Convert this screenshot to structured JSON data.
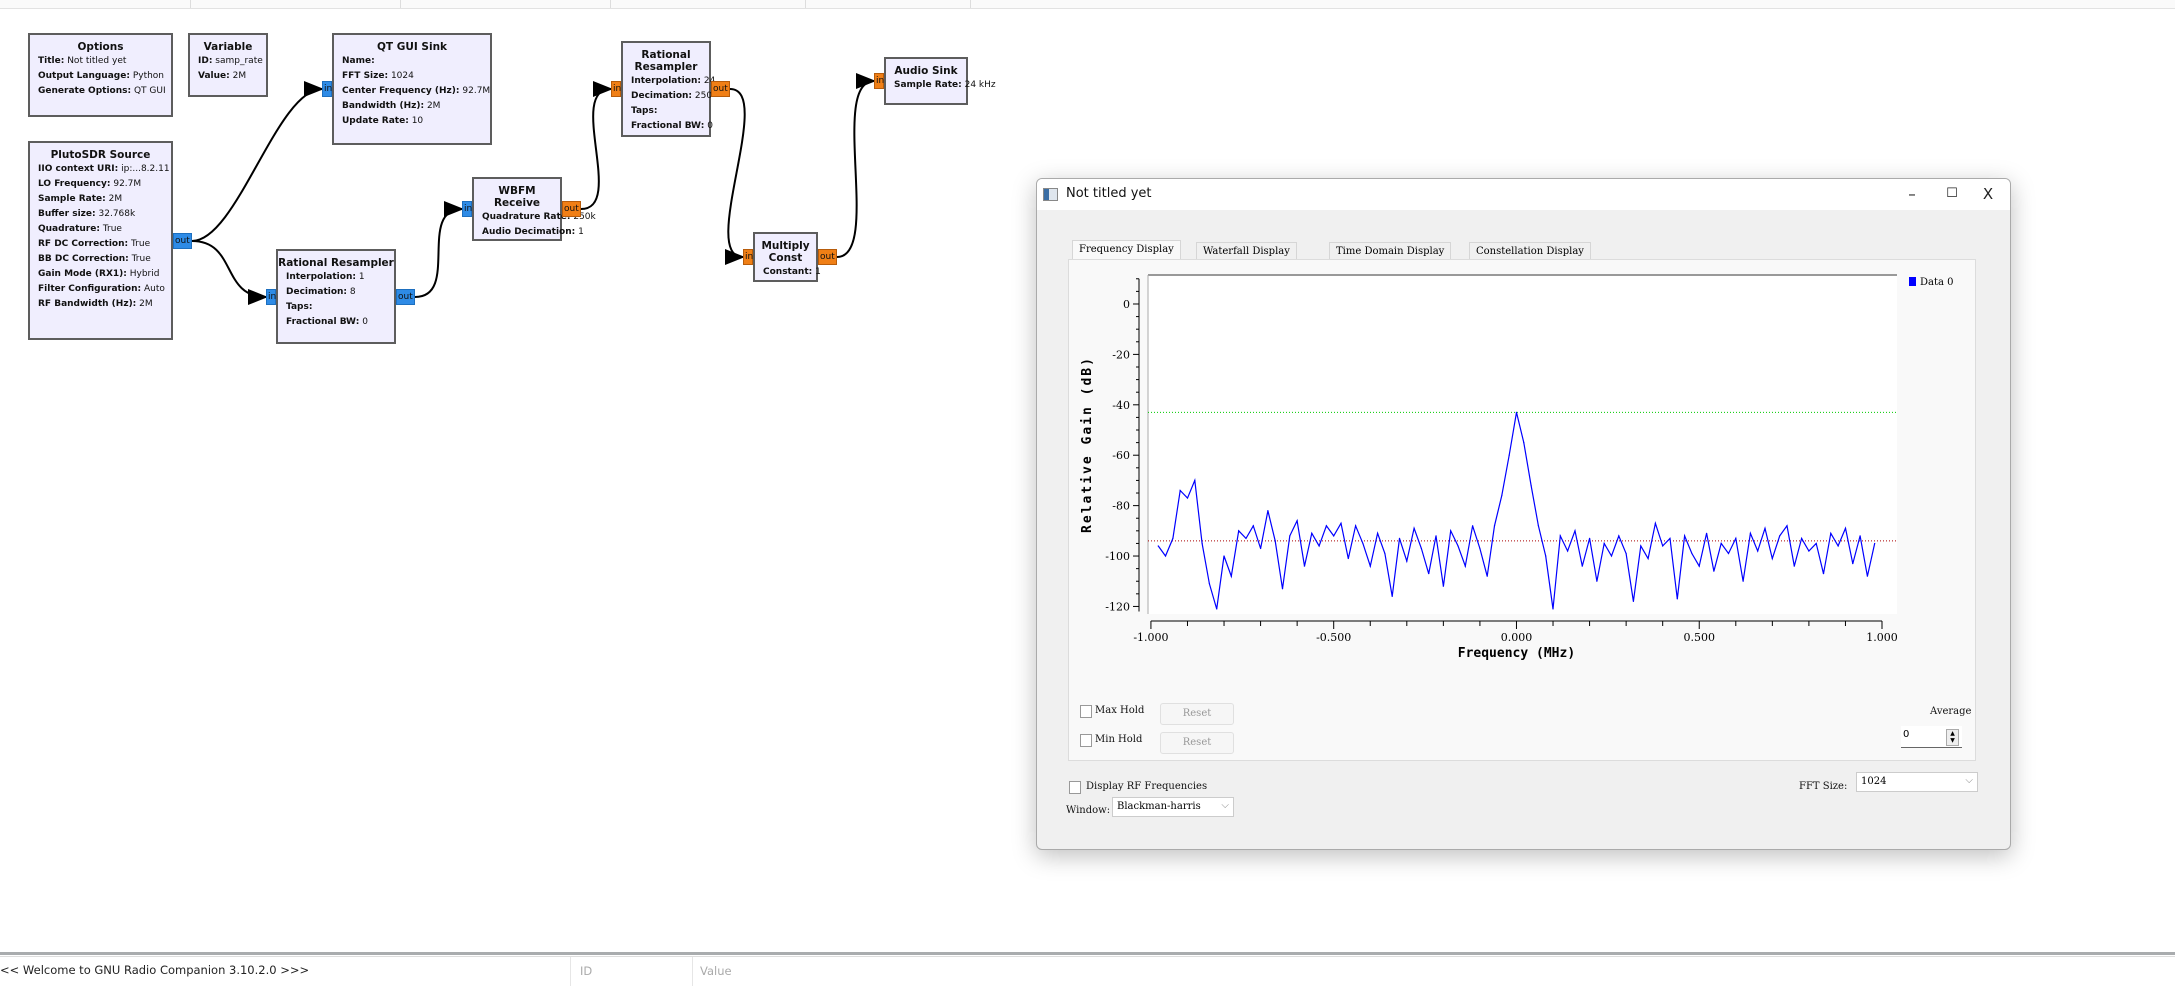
{
  "app": {
    "status_message": "<< Welcome to GNU Radio Companion 3.10.2.0 >>>",
    "variables_panel": {
      "col_id": "ID",
      "col_value": "Value"
    }
  },
  "blocks": [
    {
      "title": "Options",
      "params": [
        {
          "k": "Title:",
          "v": "Not titled yet"
        },
        {
          "k": "Output Language:",
          "v": "Python"
        },
        {
          "k": "Generate Options:",
          "v": "QT GUI"
        }
      ]
    },
    {
      "title": "Variable",
      "params": [
        {
          "k": "ID:",
          "v": "samp_rate"
        },
        {
          "k": "Value:",
          "v": "2M"
        }
      ]
    },
    {
      "title": "QT GUI Sink",
      "params": [
        {
          "k": "Name:",
          "v": ""
        },
        {
          "k": "FFT Size:",
          "v": "1024"
        },
        {
          "k": "Center Frequency (Hz):",
          "v": "92.7M"
        },
        {
          "k": "Bandwidth (Hz):",
          "v": "2M"
        },
        {
          "k": "Update Rate:",
          "v": "10"
        }
      ],
      "in": "in",
      "in_color": "blue"
    },
    {
      "title": "PlutoSDR Source",
      "params": [
        {
          "k": "IIO context URI:",
          "v": "ip:...8.2.11"
        },
        {
          "k": "LO Frequency:",
          "v": "92.7M"
        },
        {
          "k": "Sample Rate:",
          "v": "2M"
        },
        {
          "k": "Buffer size:",
          "v": "32.768k"
        },
        {
          "k": "Quadrature:",
          "v": "True"
        },
        {
          "k": "RF DC Correction:",
          "v": "True"
        },
        {
          "k": "BB DC Correction:",
          "v": "True"
        },
        {
          "k": "Gain Mode (RX1):",
          "v": "Hybrid"
        },
        {
          "k": "Filter Configuration:",
          "v": "Auto"
        },
        {
          "k": "RF Bandwidth (Hz):",
          "v": "2M"
        }
      ],
      "out": "out",
      "out_color": "blue"
    },
    {
      "title": "Rational Resampler",
      "params": [
        {
          "k": "Interpolation:",
          "v": "1"
        },
        {
          "k": "Decimation:",
          "v": "8"
        },
        {
          "k": "Taps:",
          "v": ""
        },
        {
          "k": "Fractional BW:",
          "v": "0"
        }
      ],
      "in": "in",
      "in_color": "blue",
      "out": "out",
      "out_color": "blue"
    },
    {
      "title": "WBFM Receive",
      "params": [
        {
          "k": "Quadrature Rate:",
          "v": "250k"
        },
        {
          "k": "Audio Decimation:",
          "v": "1"
        }
      ],
      "in": "in",
      "in_color": "blue",
      "out": "out",
      "out_color": "orange"
    },
    {
      "title": "Rational Resampler",
      "params": [
        {
          "k": "Interpolation:",
          "v": "24"
        },
        {
          "k": "Decimation:",
          "v": "250"
        },
        {
          "k": "Taps:",
          "v": ""
        },
        {
          "k": "Fractional BW:",
          "v": "0"
        }
      ],
      "in": "in",
      "in_color": "orange",
      "out": "out",
      "out_color": "orange"
    },
    {
      "title": "Multiply Const",
      "params": [
        {
          "k": "Constant:",
          "v": "1"
        }
      ],
      "in": "in",
      "in_color": "orange",
      "out": "out",
      "out_color": "orange"
    },
    {
      "title": "Audio Sink",
      "params": [
        {
          "k": "Sample Rate:",
          "v": "24 kHz"
        }
      ],
      "in": "in",
      "in_color": "orange"
    }
  ],
  "window": {
    "title": "Not titled yet",
    "controls": {
      "minimize": "–",
      "maximize": "☐",
      "close": "X"
    },
    "tabs": [
      {
        "label": "Frequency Display",
        "active": true
      },
      {
        "label": "Waterfall Display",
        "active": false
      },
      {
        "label": "Time Domain Display",
        "active": false
      },
      {
        "label": "Constellation Display",
        "active": false
      }
    ],
    "max_hold": {
      "label": "Max Hold",
      "checked": false,
      "reset": "Reset"
    },
    "min_hold": {
      "label": "Min Hold",
      "checked": false,
      "reset": "Reset"
    },
    "average": {
      "label": "Average",
      "value": "0"
    },
    "display_rf": {
      "label": "Display RF Frequencies",
      "checked": false
    },
    "fft_size": {
      "label": "FFT Size:",
      "value": "1024"
    },
    "window_fn": {
      "label": "Window:",
      "value": "Blackman-harris"
    }
  },
  "chart_data": {
    "type": "line",
    "xlabel": "Frequency (MHz)",
    "ylabel": "Relative Gain (dB)",
    "xlim": [
      -1.008,
      1.041
    ],
    "ylim": [
      -123,
      11.5
    ],
    "xticks": [
      "-1.000",
      "-0.500",
      "0.000",
      "0.500",
      "1.000"
    ],
    "yticks": [
      "0",
      "-20",
      "-40",
      "-60",
      "-80",
      "-100",
      "-120"
    ],
    "grid": false,
    "legend": "right",
    "max_hold_marker": -43,
    "average_marker": -94,
    "marker_colors": {
      "max": "#00cc00",
      "avg": "#aa0000"
    },
    "series": [
      {
        "name": "Data 0",
        "color": "#0000ff",
        "x_start": -0.98,
        "x_step": 0.02,
        "values": [
          -96,
          -100,
          -93,
          -74,
          -77,
          -70,
          -95,
          -111,
          -121,
          -100,
          -108,
          -90,
          -93,
          -88,
          -97,
          -82,
          -94,
          -113,
          -92,
          -86,
          -104,
          -91,
          -96,
          -88,
          -92,
          -87,
          -101,
          -88,
          -95,
          -104,
          -91,
          -99,
          -116,
          -93,
          -102,
          -89,
          -97,
          -107,
          -92,
          -112,
          -90,
          -96,
          -104,
          -88,
          -97,
          -108,
          -88,
          -76,
          -60,
          -43,
          -55,
          -72,
          -88,
          -100,
          -121,
          -92,
          -98,
          -90,
          -104,
          -93,
          -110,
          -95,
          -100,
          -92,
          -99,
          -118,
          -96,
          -101,
          -87,
          -96,
          -93,
          -117,
          -92,
          -99,
          -104,
          -91,
          -106,
          -95,
          -99,
          -93,
          -110,
          -91,
          -98,
          -89,
          -101,
          -92,
          -88,
          -104,
          -93,
          -98,
          -95,
          -107,
          -91,
          -96,
          -89,
          -103,
          -92,
          -108,
          -95
        ]
      }
    ]
  }
}
